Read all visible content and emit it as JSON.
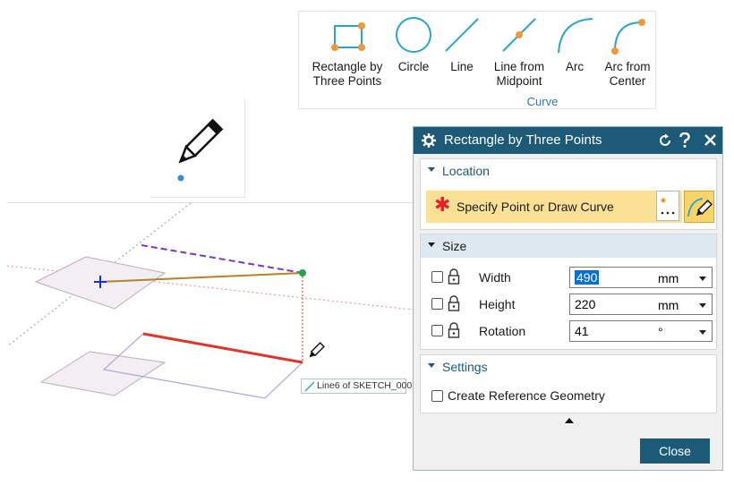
{
  "ribbon": {
    "group_label": "Curve",
    "accent_color": "#2aa5c7",
    "node_color": "#f0983a",
    "items": [
      {
        "label": "Rectangle by\nThree Points",
        "icon": "rectangle-three-points-icon"
      },
      {
        "label": "Circle",
        "icon": "circle-icon"
      },
      {
        "label": "Line",
        "icon": "line-icon"
      },
      {
        "label": "Line from\nMidpoint",
        "icon": "line-midpoint-icon"
      },
      {
        "label": "Arc",
        "icon": "arc-icon"
      },
      {
        "label": "Arc from\nCenter",
        "icon": "arc-center-icon"
      }
    ]
  },
  "viewport": {
    "tooltip": "Line6 of SKETCH_000"
  },
  "dialog": {
    "title": "Rectangle by Three Points",
    "title_bar_color": "#1c5a78",
    "location": {
      "header": "Location",
      "specify": "Specify Point or Draw Curve",
      "point_icon": "point-dialog-icon",
      "draw_icon": "draw-curve-icon"
    },
    "size": {
      "header": "Size",
      "width_label": "Width",
      "width_value": "490",
      "width_unit": "mm",
      "height_label": "Height",
      "height_value": "220",
      "height_unit": "mm",
      "rotation_label": "Rotation",
      "rotation_value": "41",
      "rotation_unit": "°"
    },
    "settings": {
      "header": "Settings",
      "reference": "Create Reference Geometry"
    },
    "close_label": "Close"
  }
}
